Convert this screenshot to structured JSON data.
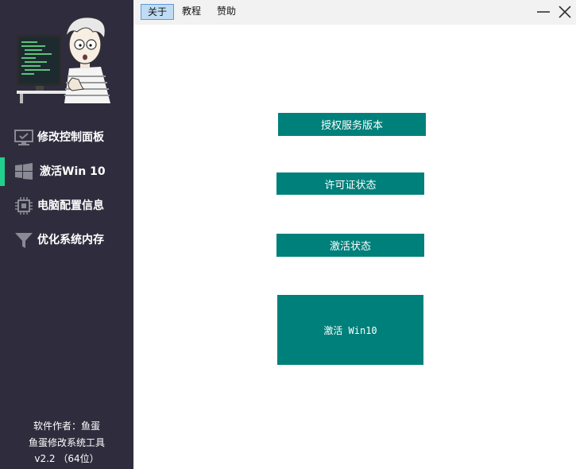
{
  "menu": {
    "items": [
      "关于",
      "教程",
      "赞助"
    ],
    "selected": "关于"
  },
  "window_controls": {
    "minimize_icon": "minimize-icon",
    "close_icon": "close-icon"
  },
  "sidebar": {
    "avatar": "cartoon-programmer-illustration",
    "items": [
      {
        "label": "修改控制面板",
        "icon": "monitor-check-icon",
        "active": false
      },
      {
        "label": "激活Win 10",
        "icon": "windows-logo-icon",
        "active": true
      },
      {
        "label": "电脑配置信息",
        "icon": "chip-icon",
        "active": false
      },
      {
        "label": "优化系统内存",
        "icon": "funnel-icon",
        "active": false
      }
    ],
    "active_color": "#21d08c",
    "author": "软件作者：鱼蛋",
    "app_name": "鱼蛋修改系统工具",
    "version": "v2.2 （64位）"
  },
  "main": {
    "buttons": [
      {
        "label": "授权服务版本"
      },
      {
        "label": "许可证状态"
      },
      {
        "label": "激活状态"
      },
      {
        "label": "激活 Win10"
      }
    ]
  },
  "colors": {
    "sidebar_bg": "#2f2d3d",
    "button_bg": "#00807b",
    "topbar_bg": "#f2f2f2"
  }
}
